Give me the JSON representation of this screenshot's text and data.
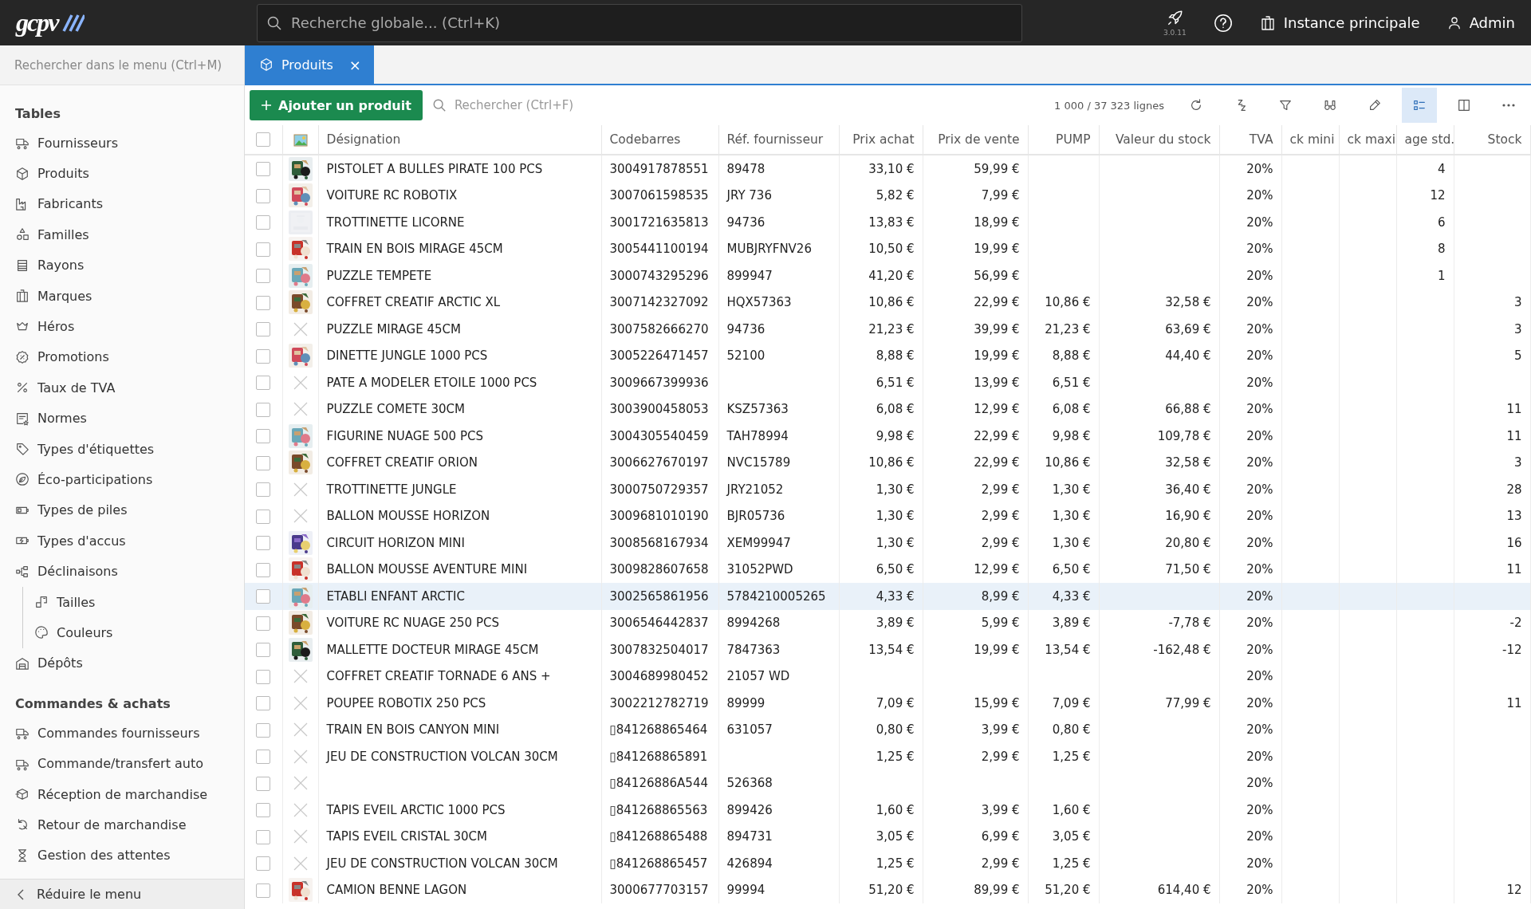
{
  "top_bar": {
    "logo": "gcpv",
    "search": {
      "placeholder": "Recherche globale... (Ctrl+K)"
    },
    "version": "3.0.11",
    "instance": "Instance principale",
    "user": "Admin"
  },
  "sidebar": {
    "search": {
      "placeholder": "Rechercher dans le menu (Ctrl+M)"
    },
    "sections": [
      {
        "title": "Tables",
        "items": [
          {
            "label": "Fournisseurs",
            "kind": "truck",
            "selected": false
          },
          {
            "label": "Produits",
            "kind": "cube",
            "selected": false
          },
          {
            "label": "Fabricants",
            "kind": "factory",
            "selected": false
          },
          {
            "label": "Familles",
            "kind": "shapes",
            "selected": false
          },
          {
            "label": "Rayons",
            "kind": "shelves",
            "selected": false
          },
          {
            "label": "Marques",
            "kind": "building",
            "selected": false
          },
          {
            "label": "Héros",
            "kind": "crown",
            "selected": false
          },
          {
            "label": "Promotions",
            "kind": "percent-badge",
            "selected": false
          },
          {
            "label": "Taux de TVA",
            "kind": "percent",
            "selected": false
          },
          {
            "label": "Normes",
            "kind": "document",
            "selected": false
          },
          {
            "label": "Types d'étiquettes",
            "kind": "tag",
            "selected": false
          },
          {
            "label": "Éco-participations",
            "kind": "leaf",
            "selected": false
          },
          {
            "label": "Types de piles",
            "kind": "battery",
            "selected": false
          },
          {
            "label": "Types d'accus",
            "kind": "battery-bolt",
            "selected": false
          },
          {
            "label": "Déclinaisons",
            "kind": "hierarchy",
            "selected": false,
            "children": [
              {
                "label": "Tailles",
                "kind": "size",
                "selected": false
              },
              {
                "label": "Couleurs",
                "kind": "palette",
                "selected": false
              }
            ]
          },
          {
            "label": "Dépôts",
            "kind": "warehouse",
            "selected": false
          }
        ]
      },
      {
        "title": "Commandes & achats",
        "items": [
          {
            "label": "Commandes fournisseurs",
            "kind": "truck",
            "selected": false
          },
          {
            "label": "Commande/transfert auto",
            "kind": "truck",
            "selected": false
          },
          {
            "label": "Réception de marchandise",
            "kind": "package",
            "selected": false
          },
          {
            "label": "Retour de marchandise",
            "kind": "return",
            "selected": false
          },
          {
            "label": "Gestion des attentes",
            "kind": "hourglass",
            "selected": false
          }
        ]
      }
    ],
    "collapse": "Réduire le menu"
  },
  "tabs": [
    {
      "label": "Produits",
      "close": "×",
      "selected": true
    }
  ],
  "toolbar": {
    "add_button": "Ajouter un produit",
    "search": {
      "placeholder": "Rechercher (Ctrl+F)"
    },
    "count": "1 000 / 37 323 lignes",
    "tools": [
      {
        "kind": "refresh",
        "selected": false
      },
      {
        "kind": "sleep",
        "selected": false
      },
      {
        "kind": "filter",
        "selected": false
      },
      {
        "kind": "binoculars",
        "selected": false
      },
      {
        "kind": "pencil",
        "selected": false
      },
      {
        "kind": "list",
        "selected": true
      },
      {
        "kind": "columns",
        "selected": false
      },
      {
        "kind": "more",
        "selected": false
      }
    ]
  },
  "table": {
    "select_all_checked": false,
    "columns": [
      "Désignation",
      "Codebarres",
      "Réf. fournisseur",
      "Prix achat",
      "Prix de vente",
      "PUMP",
      "Valeur du stock",
      "TVA",
      "ck mini",
      "ck maxi",
      "age std.",
      "Stock"
    ],
    "rows": [
      {
        "checked": false,
        "selected": false,
        "kind": "picture",
        "designation": "PISTOLET A BULLES PIRATE 100 PCS",
        "codebarres": "3004917878551",
        "ref_fournisseur": "89478",
        "prix_achat": "33,10 €",
        "prix_vente": "59,99 €",
        "tva": "20%",
        "column_13": "4"
      },
      {
        "checked": false,
        "selected": false,
        "kind": "picture",
        "designation": "VOITURE RC ROBOTIX",
        "codebarres": "3007061598535",
        "ref_fournisseur": "JRY 736",
        "prix_achat": "5,82 €",
        "prix_vente": "7,99 €",
        "tva": "20%",
        "column_13": "12"
      },
      {
        "checked": false,
        "selected": false,
        "kind": "blank",
        "designation": "TROTTINETTE LICORNE",
        "codebarres": "3001721635813",
        "ref_fournisseur": "94736",
        "prix_achat": "13,83 €",
        "prix_vente": "18,99 €",
        "tva": "20%",
        "column_13": "6"
      },
      {
        "checked": false,
        "selected": false,
        "kind": "picture",
        "designation": "TRAIN EN BOIS MIRAGE 45CM",
        "codebarres": "3005441100194",
        "ref_fournisseur": "MUBJRYFNV26",
        "prix_achat": "10,50 €",
        "prix_vente": "19,99 €",
        "tva": "20%",
        "column_13": "8"
      },
      {
        "checked": false,
        "selected": false,
        "kind": "picture",
        "designation": "PUZZLE TEMPETE",
        "codebarres": "3000743295296",
        "ref_fournisseur": "899947",
        "prix_achat": "41,20 €",
        "prix_vente": "56,99 €",
        "tva": "20%",
        "column_13": "1"
      },
      {
        "checked": false,
        "selected": false,
        "kind": "picture",
        "designation": "COFFRET CREATIF ARCTIC XL",
        "codebarres": "3007142327092",
        "ref_fournisseur": "HQX57363",
        "prix_achat": "10,86 €",
        "prix_vente": "22,99 €",
        "pump": "10,86 €",
        "valeur_stock": "32,58 €",
        "tva": "20%",
        "stock": "3"
      },
      {
        "checked": false,
        "selected": false,
        "kind": "none",
        "designation": "PUZZLE MIRAGE 45CM",
        "codebarres": "3007582666270",
        "ref_fournisseur": "94736",
        "prix_achat": "21,23 €",
        "prix_vente": "39,99 €",
        "pump": "21,23 €",
        "valeur_stock": "63,69 €",
        "tva": "20%",
        "stock": "3"
      },
      {
        "checked": false,
        "selected": false,
        "kind": "picture",
        "designation": "DINETTE JUNGLE 1000 PCS",
        "codebarres": "3005226471457",
        "ref_fournisseur": "52100",
        "prix_achat": "8,88 €",
        "prix_vente": "19,99 €",
        "pump": "8,88 €",
        "valeur_stock": "44,40 €",
        "tva": "20%",
        "stock": "5"
      },
      {
        "checked": false,
        "selected": false,
        "kind": "none",
        "designation": "PATE A MODELER ETOILE 1000 PCS",
        "codebarres": "3009667399936",
        "prix_achat": "6,51 €",
        "prix_vente": "13,99 €",
        "pump": "6,51 €",
        "tva": "20%"
      },
      {
        "checked": false,
        "selected": false,
        "kind": "none",
        "designation": "PUZZLE COMETE 30CM",
        "codebarres": "3003900458053",
        "ref_fournisseur": "KSZ57363",
        "prix_achat": "6,08 €",
        "prix_vente": "12,99 €",
        "pump": "6,08 €",
        "valeur_stock": "66,88 €",
        "tva": "20%",
        "stock": "11"
      },
      {
        "checked": false,
        "selected": false,
        "kind": "picture",
        "designation": "FIGURINE NUAGE 500 PCS",
        "codebarres": "3004305540459",
        "ref_fournisseur": "TAH78994",
        "prix_achat": "9,98 €",
        "prix_vente": "22,99 €",
        "pump": "9,98 €",
        "valeur_stock": "109,78 €",
        "tva": "20%",
        "stock": "11"
      },
      {
        "checked": false,
        "selected": false,
        "kind": "picture",
        "designation": "COFFRET CREATIF ORION",
        "codebarres": "3006627670197",
        "ref_fournisseur": "NVC15789",
        "prix_achat": "10,86 €",
        "prix_vente": "22,99 €",
        "pump": "10,86 €",
        "valeur_stock": "32,58 €",
        "tva": "20%",
        "stock": "3"
      },
      {
        "checked": false,
        "selected": false,
        "kind": "none",
        "designation": "TROTTINETTE JUNGLE",
        "codebarres": "3000750729357",
        "ref_fournisseur": "JRY21052",
        "prix_achat": "1,30 €",
        "prix_vente": "2,99 €",
        "pump": "1,30 €",
        "valeur_stock": "36,40 €",
        "tva": "20%",
        "stock": "28"
      },
      {
        "checked": false,
        "selected": false,
        "kind": "none",
        "designation": "BALLON MOUSSE HORIZON",
        "codebarres": "3009681010190",
        "ref_fournisseur": "BJR05736",
        "prix_achat": "1,30 €",
        "prix_vente": "2,99 €",
        "pump": "1,30 €",
        "valeur_stock": "16,90 €",
        "tva": "20%",
        "stock": "13"
      },
      {
        "checked": false,
        "selected": false,
        "kind": "picture",
        "designation": "CIRCUIT HORIZON MINI",
        "codebarres": "3008568167934",
        "ref_fournisseur": "XEM99947",
        "prix_achat": "1,30 €",
        "prix_vente": "2,99 €",
        "pump": "1,30 €",
        "valeur_stock": "20,80 €",
        "tva": "20%",
        "stock": "16"
      },
      {
        "checked": false,
        "selected": false,
        "kind": "picture",
        "designation": "BALLON MOUSSE AVENTURE MINI",
        "codebarres": "3009828607658",
        "ref_fournisseur": "31052PWD",
        "prix_achat": "6,50 €",
        "prix_vente": "12,99 €",
        "pump": "6,50 €",
        "valeur_stock": "71,50 €",
        "tva": "20%",
        "stock": "11"
      },
      {
        "checked": false,
        "selected": true,
        "kind": "picture",
        "designation": "ETABLI ENFANT ARCTIC",
        "codebarres": "3002565861956",
        "ref_fournisseur": "5784210005265",
        "prix_achat": "4,33 €",
        "prix_vente": "8,99 €",
        "pump": "4,33 €",
        "tva": "20%"
      },
      {
        "checked": false,
        "selected": false,
        "kind": "picture",
        "designation": "VOITURE RC NUAGE 250 PCS",
        "codebarres": "3006546442837",
        "ref_fournisseur": "8994268",
        "prix_achat": "3,89 €",
        "prix_vente": "5,99 €",
        "pump": "3,89 €",
        "valeur_stock": "-7,78 €",
        "tva": "20%",
        "stock": "-2"
      },
      {
        "checked": false,
        "selected": false,
        "kind": "picture",
        "designation": "MALLETTE DOCTEUR MIRAGE 45CM",
        "codebarres": "3007832504017",
        "ref_fournisseur": "7847363",
        "prix_achat": "13,54 €",
        "prix_vente": "19,99 €",
        "pump": "13,54 €",
        "valeur_stock": "-162,48 €",
        "tva": "20%",
        "stock": "-12"
      },
      {
        "checked": false,
        "selected": false,
        "kind": "none",
        "designation": "COFFRET CREATIF TORNADE 6 ANS +",
        "codebarres": "3004689980452",
        "ref_fournisseur": "21057 WD",
        "tva": "20%"
      },
      {
        "checked": false,
        "selected": false,
        "kind": "none",
        "designation": "POUPEE ROBOTIX 250 PCS",
        "codebarres": "3002212782719",
        "ref_fournisseur": "89999",
        "prix_achat": "7,09 €",
        "prix_vente": "15,99 €",
        "pump": "7,09 €",
        "valeur_stock": "77,99 €",
        "tva": "20%",
        "stock": "11"
      },
      {
        "checked": false,
        "selected": false,
        "kind": "none",
        "designation": "TRAIN EN BOIS CANYON MINI",
        "codebarres": "▯841268865464",
        "ref_fournisseur": "631057",
        "prix_achat": "0,80 €",
        "prix_vente": "3,99 €",
        "pump": "0,80 €",
        "tva": "20%"
      },
      {
        "checked": false,
        "selected": false,
        "kind": "none",
        "designation": "JEU DE CONSTRUCTION VOLCAN 30CM",
        "codebarres": "▯841268865891",
        "prix_achat": "1,25 €",
        "prix_vente": "2,99 €",
        "pump": "1,25 €",
        "tva": "20%"
      },
      {
        "checked": false,
        "selected": false,
        "kind": "none",
        "codebarres": "▯84126886A544",
        "ref_fournisseur": "526368",
        "tva": "20%"
      },
      {
        "checked": false,
        "selected": false,
        "kind": "none",
        "designation": "TAPIS EVEIL ARCTIC 1000 PCS",
        "codebarres": "▯841268865563",
        "ref_fournisseur": "899426",
        "prix_achat": "1,60 €",
        "prix_vente": "3,99 €",
        "pump": "1,60 €",
        "tva": "20%"
      },
      {
        "checked": false,
        "selected": false,
        "kind": "none",
        "designation": "TAPIS EVEIL CRISTAL 30CM",
        "codebarres": "▯841268865488",
        "ref_fournisseur": "894731",
        "prix_achat": "3,05 €",
        "prix_vente": "6,99 €",
        "pump": "3,05 €",
        "tva": "20%"
      },
      {
        "checked": false,
        "selected": false,
        "kind": "none",
        "designation": "JEU DE CONSTRUCTION VOLCAN 30CM",
        "codebarres": "▯841268865457",
        "ref_fournisseur": "426894",
        "prix_achat": "1,25 €",
        "prix_vente": "2,99 €",
        "pump": "1,25 €",
        "tva": "20%"
      },
      {
        "checked": false,
        "selected": false,
        "kind": "picture",
        "designation": "CAMION BENNE LAGON",
        "codebarres": "3000677703157",
        "ref_fournisseur": "99994",
        "prix_achat": "51,20 €",
        "prix_vente": "89,99 €",
        "pump": "51,20 €",
        "valeur_stock": "614,40 €",
        "tva": "20%",
        "stock": "12"
      }
    ]
  }
}
